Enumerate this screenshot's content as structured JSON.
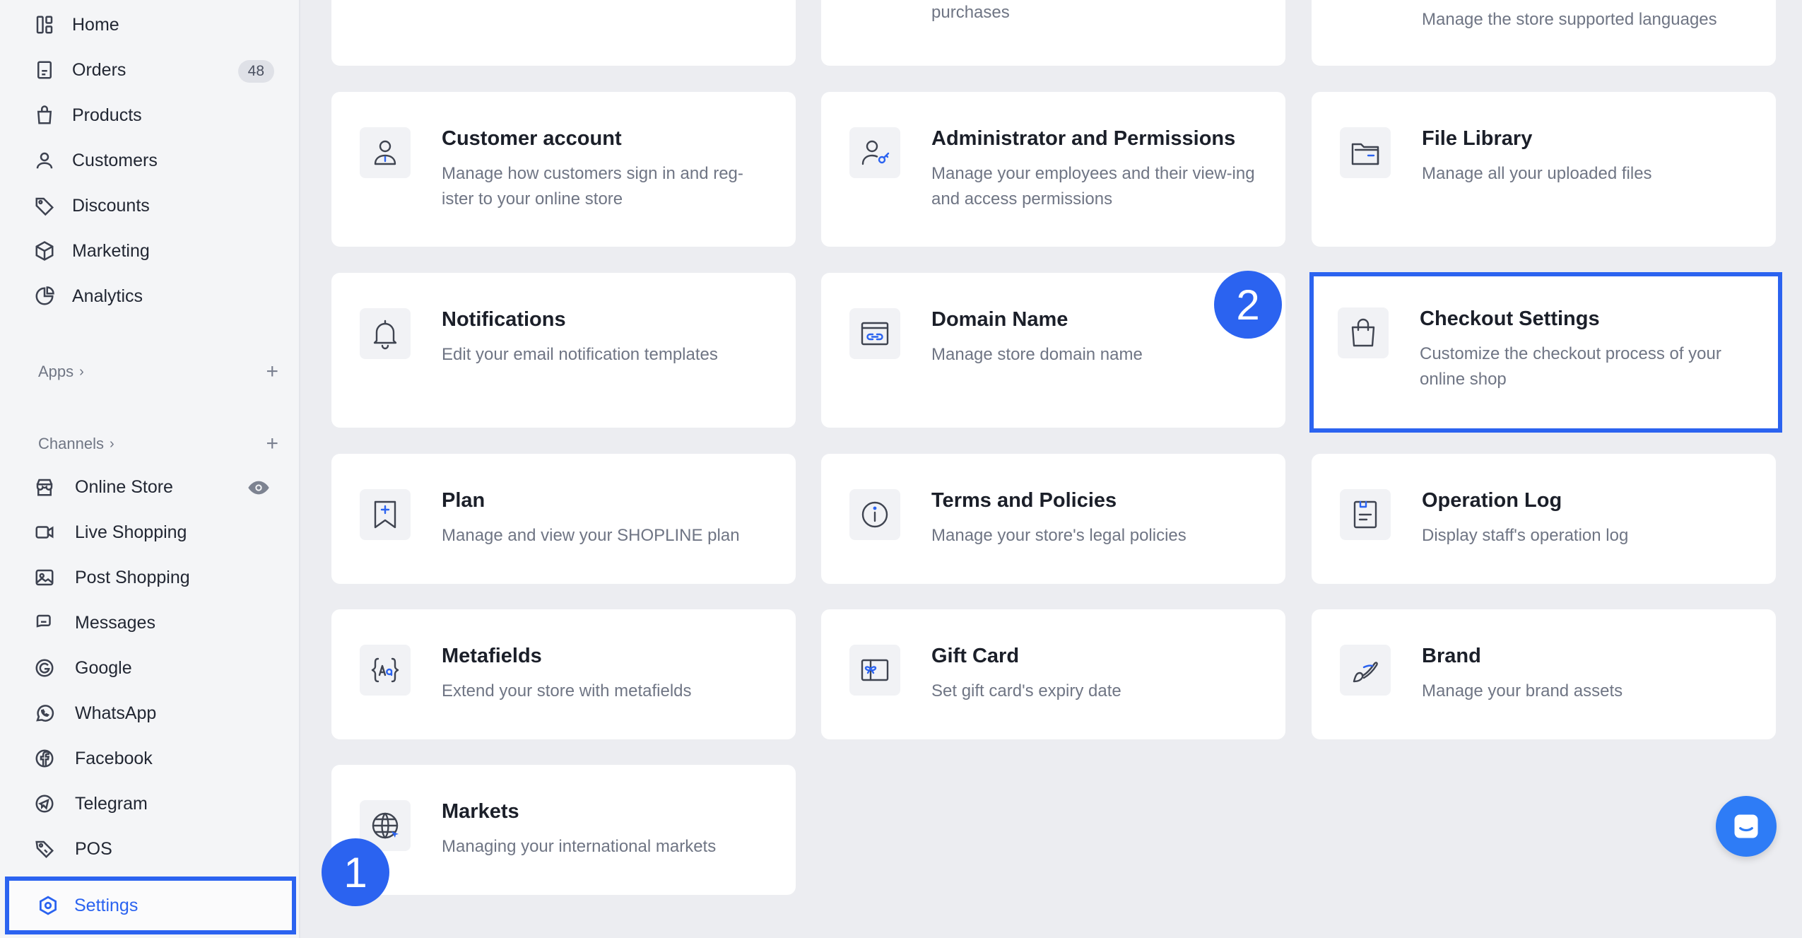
{
  "sidebar": {
    "home": "Home",
    "orders": "Orders",
    "orders_count": "48",
    "products": "Products",
    "customers": "Customers",
    "discounts": "Discounts",
    "marketing": "Marketing",
    "analytics": "Analytics",
    "apps_label": "Apps",
    "channels_label": "Channels",
    "channels": {
      "online_store": "Online Store",
      "live_shopping": "Live Shopping",
      "post_shopping": "Post Shopping",
      "messages": "Messages",
      "google": "Google",
      "whatsapp": "WhatsApp",
      "facebook": "Facebook",
      "telegram": "Telegram",
      "pos": "POS"
    },
    "settings": "Settings"
  },
  "cards": {
    "top_middle_desc": "purchases",
    "top_right_desc": "Manage the store supported languages",
    "customer_account": {
      "title": "Customer account",
      "desc": "Manage how customers sign in and reg-ister to your online store"
    },
    "admin": {
      "title": "Administrator and Permissions",
      "desc": "Manage your employees and their view-ing and access permissions"
    },
    "file_library": {
      "title": "File Library",
      "desc": "Manage all your uploaded files"
    },
    "notifications": {
      "title": "Notifications",
      "desc": "Edit your email notification templates"
    },
    "domain": {
      "title": "Domain Name",
      "desc": "Manage store domain name"
    },
    "checkout": {
      "title": "Checkout Settings",
      "desc": "Customize the checkout process of your online shop"
    },
    "plan": {
      "title": "Plan",
      "desc": "Manage and view your SHOPLINE plan"
    },
    "terms": {
      "title": "Terms and Policies",
      "desc": "Manage your store's legal policies"
    },
    "oplog": {
      "title": "Operation Log",
      "desc": "Display staff's operation log"
    },
    "metafields": {
      "title": "Metafields",
      "desc": "Extend your store with metafields"
    },
    "giftcard": {
      "title": "Gift Card",
      "desc": "Set gift card's expiry date"
    },
    "brand": {
      "title": "Brand",
      "desc": "Manage your brand assets"
    },
    "markets": {
      "title": "Markets",
      "desc": "Managing your international markets"
    }
  },
  "steps": {
    "one": "1",
    "two": "2"
  },
  "colors": {
    "accent": "#2b63f0",
    "chat": "#2e7cf6"
  }
}
